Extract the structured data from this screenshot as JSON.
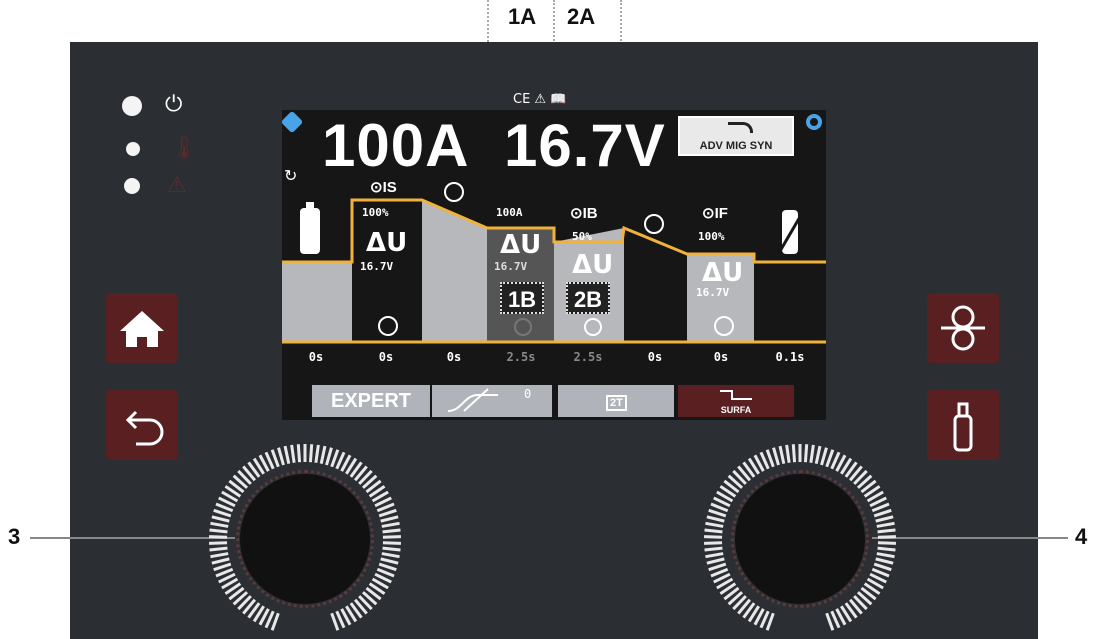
{
  "callouts": {
    "top_left": "1A",
    "top_right": "2A",
    "left": "3",
    "right": "4"
  },
  "screen": {
    "current": "100A",
    "voltage": "16.7V",
    "mode": "ADV MIG SYN",
    "cert_marks": "CE ⚠ 📖",
    "segments": {
      "is_label": "IS",
      "is_percent": "100%",
      "is_du": "ΔU",
      "is_volt": "16.7V",
      "mid_current": "100A",
      "mid_du": "ΔU",
      "mid_volt": "16.7V",
      "ib_label": "IB",
      "ib_percent": "50%",
      "ib_du": "ΔU",
      "if_label": "IF",
      "if_percent": "100%",
      "if_du": "ΔU",
      "if_volt": "16.7V"
    },
    "tags": {
      "b1": "1B",
      "b2": "2B"
    },
    "timings": [
      "0s",
      "0s",
      "0s",
      "2.5s",
      "2.5s",
      "0s",
      "0s",
      "0.1s"
    ],
    "tabs": {
      "expert": "EXPERT",
      "slope_value": "0",
      "trigger": "2T",
      "surfa": "SURFA"
    }
  },
  "icons": {
    "power": "power-icon",
    "thermal": "thermometer-icon",
    "warning": "warning-icon",
    "home": "home-icon",
    "back": "back-arrow-icon",
    "wire": "wire-feed-icon",
    "gas": "gas-bottle-icon"
  },
  "colors": {
    "panel": "#2b2e32",
    "button": "#5a1f20",
    "accent": "#f0b23c",
    "screen_blue": "#4aa3e6"
  }
}
